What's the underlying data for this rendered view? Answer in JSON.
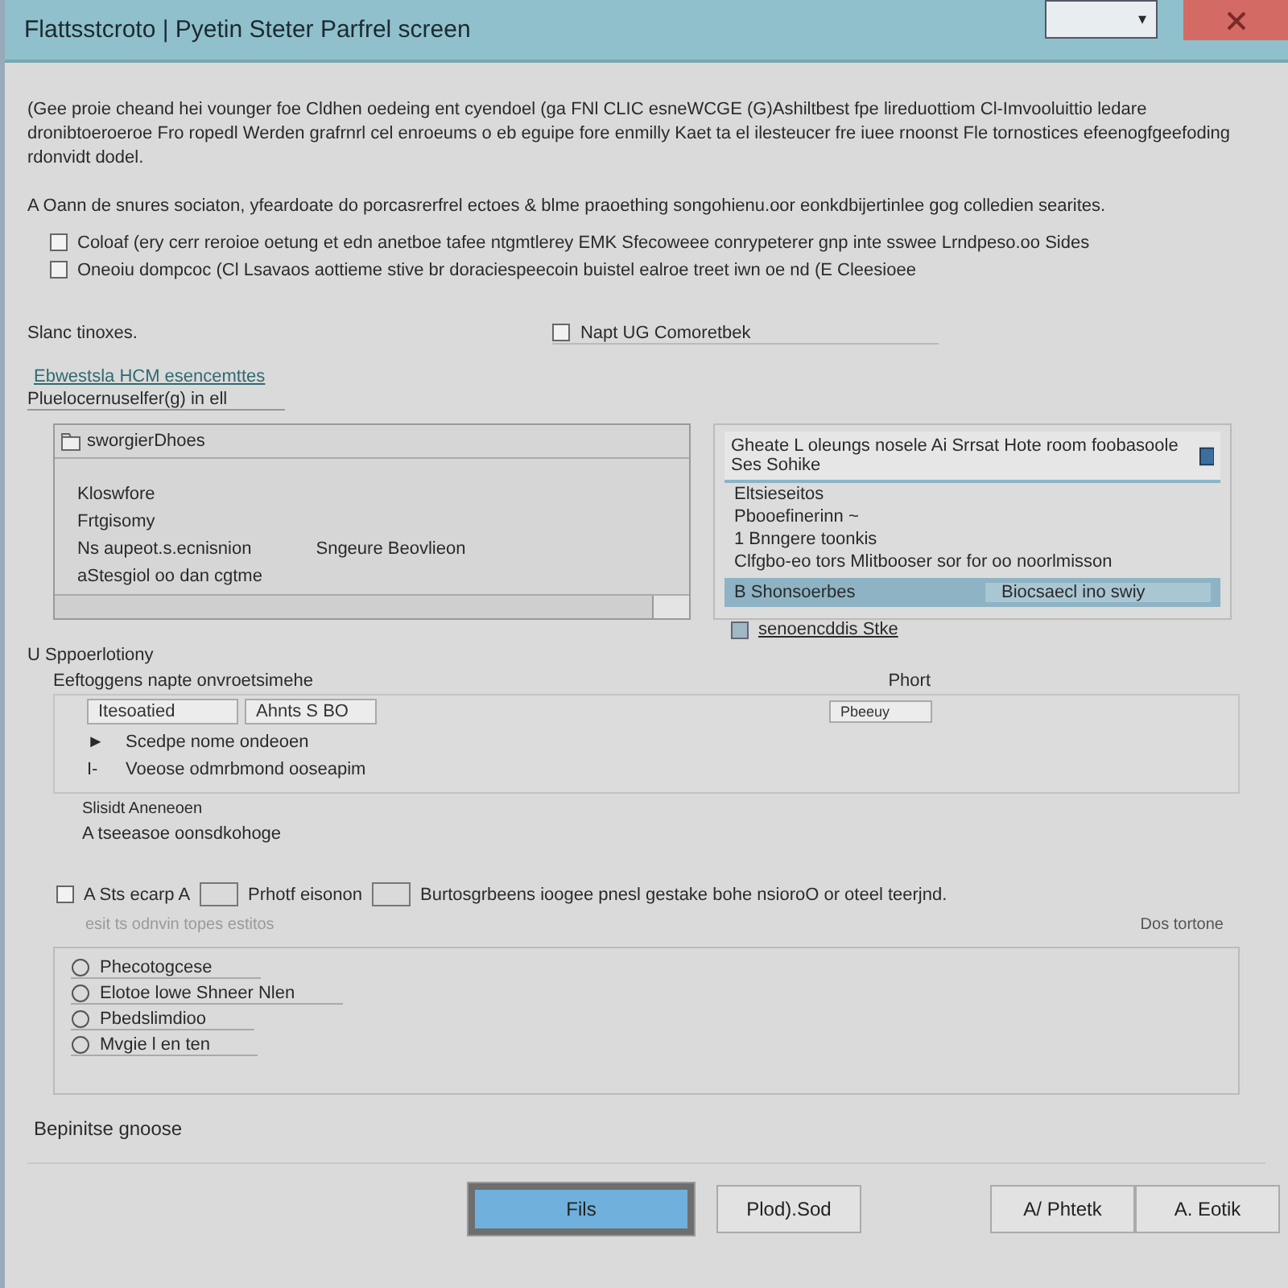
{
  "window": {
    "title": "Flattsstcroto | Pyetin Steter Parfrel screen",
    "dropdown_arrow": "▾"
  },
  "intro": "(Gee proie cheand hei vounger foe Cldhen oedeing ent cyendoel (ga FNl CLIC esneWCGE (G)Ashiltbest fpe lireduottiom Cl-Imvooluittio ledare dronibtoeroeroe Fro ropedl Werden grafrnrl cel enroeums o eb eguipe fore enmilly Kaet ta el ilesteucer fre iuee rnoonst Fle tornostices efeenogfgeefoding rdonvidt dodel.",
  "note": "A Oann de snures sociaton, yfeardoate do porcasrerfrel ectoes & blme praoething songohienu.oor eonkdbijertinlee gog colledien searites.",
  "options": [
    {
      "label": "Coloaf (ery cerr reroioe oetung et edn anetboe tafee ntgmtlerey EMK Sfecoweee conrypeterer gnp inte sswee Lrndpeso.oo Sides",
      "checked": false
    },
    {
      "label": "Oneoiu dompcoc (Cl Lsavaos aottieme stive br doraciespeecoin buistel ealroe treet iwn oe nd (E Cleesioee",
      "checked": false
    }
  ],
  "section_label": "Slanc tinoxes.",
  "option_right": {
    "label": "Napt UG Comoretbek",
    "checked": false
  },
  "link": "Ebwestsla HCM esencemttes",
  "sublabel": "Pluelocernuselfer(g) in ell",
  "left_panel": {
    "header": "sworgierDhoes",
    "items": [
      {
        "label": "Kloswfore",
        "value": ""
      },
      {
        "label": "Frtgisomy",
        "value": ""
      },
      {
        "label": "Ns aupeot.s.ecnisnion",
        "value": "Sngeure Beovlieon"
      },
      {
        "label": "aStesgiol oo dan cgtme",
        "value": ""
      }
    ]
  },
  "right_panel": {
    "header": "Gheate L oleungs nosele Ai Srrsat Hote room foobasoole Ses Sohike",
    "items": [
      {
        "label": "Eltsieseitos",
        "value": "",
        "selected": false
      },
      {
        "label": "Pbooefinerinn ~",
        "value": "",
        "selected": false
      },
      {
        "label": "1 Bnngere toonkis",
        "value": "",
        "selected": false
      },
      {
        "label": "Clfgbo-eo tors Mlitbooser sor for oo noorlmisson",
        "value": "",
        "selected": false
      },
      {
        "label": "B Shonsoerbes",
        "value": "Biocsaecl ino swiy",
        "selected": true
      }
    ],
    "footer_link": "senoencddis Stke"
  },
  "section2": {
    "title": "U Sppoerlotiony",
    "label": "Eeftoggens napte onvroetsimehe",
    "right_label": "Phort",
    "field_value": "Itesoatied",
    "field2_value": "Ahnts S BO",
    "small_field": "Pbeeuy",
    "tree": [
      {
        "marker": "►",
        "label": "Scedpe nome ondeoen"
      },
      {
        "marker": "I-",
        "label": "Voeose odmrbmond ooseapim"
      }
    ],
    "sub_items": [
      "Slisidt Aneneoen",
      "A tseeasoe oonsdkohoge"
    ]
  },
  "section3": {
    "checked": false,
    "parts": [
      "A Sts ecarp A",
      "Prhotf eisonon",
      "Burtosgrbeens ioogee pnesl gestake bohe nsioroO or oteel teerjnd."
    ],
    "hint": "esit ts odnvin topes estitos",
    "right_label": "Dos tortone",
    "items": [
      "Phecotogcese",
      "Elotoe lowe Shneer Nlen",
      "Pbedslimdioo",
      "Mvgie l en ten"
    ]
  },
  "footer_label": "Bepinitse gnoose",
  "buttons": [
    {
      "label": "Fils",
      "kind": "primary"
    },
    {
      "label": "Plod).Sod",
      "kind": "normal"
    },
    {
      "label": "A/ Phtetk",
      "kind": "normal"
    },
    {
      "label": "A. Eotik",
      "kind": "normal"
    }
  ]
}
